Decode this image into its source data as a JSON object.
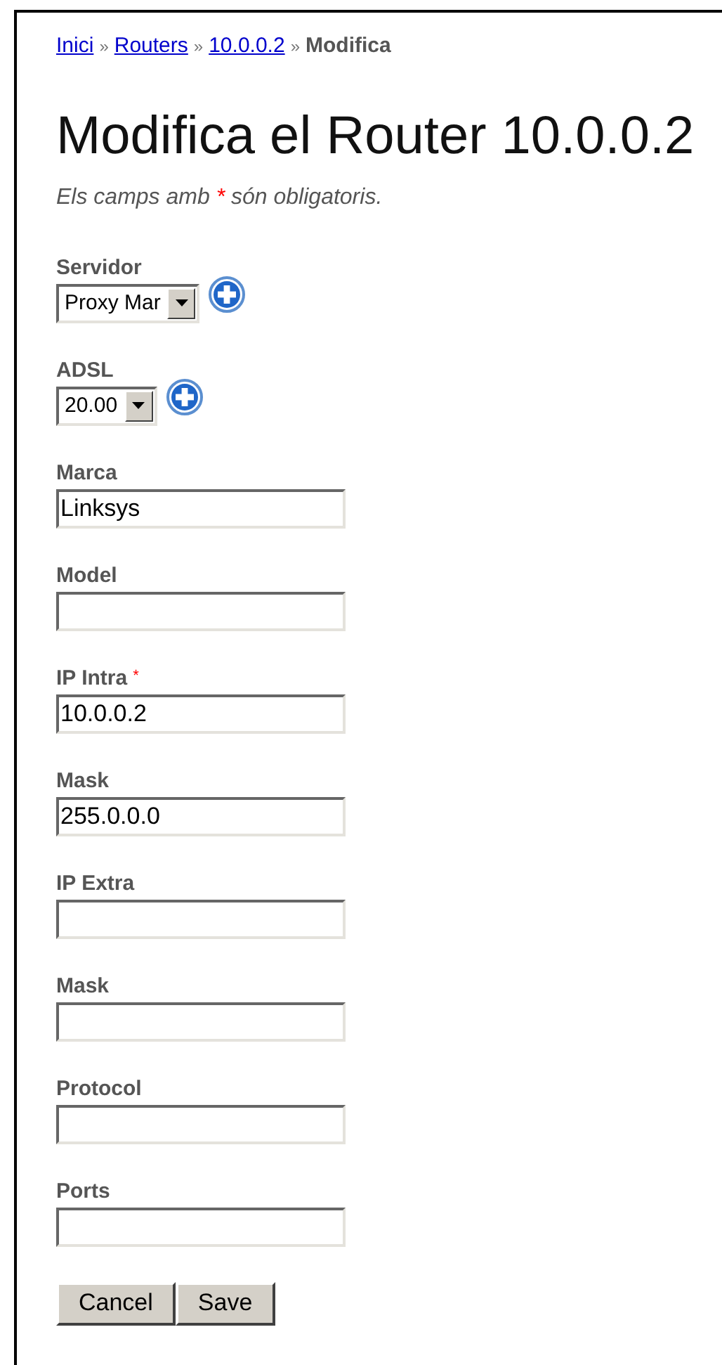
{
  "breadcrumb": [
    {
      "kind": "link",
      "text": "Inici"
    },
    {
      "kind": "separator",
      "text": "»"
    },
    {
      "kind": "link",
      "text": "Routers"
    },
    {
      "kind": "separator",
      "text": "»"
    },
    {
      "kind": "link",
      "text": "10.0.0.2"
    },
    {
      "kind": "separator",
      "text": "»"
    },
    {
      "kind": "current",
      "text": "Modifica"
    }
  ],
  "title": "Modifica el Router 10.0.0.2",
  "note": {
    "before": "Els camps amb",
    "mark": "*",
    "after": "són obligatoris."
  },
  "fields": [
    {
      "kind": "select",
      "label": "Servidor",
      "value": "Proxy Mar"
    },
    {
      "kind": "select",
      "label": "ADSL",
      "value": "20.00"
    },
    {
      "kind": "text",
      "label": "Marca",
      "value": "Linksys"
    },
    {
      "kind": "text",
      "label": "Model"
    },
    {
      "kind": "text",
      "label": "IP Intra",
      "value": "10.0.0.2",
      "mark": "*"
    },
    {
      "kind": "text",
      "label": "Mask",
      "value": "255.0.0.0"
    },
    {
      "kind": "text",
      "label": "IP Extra"
    },
    {
      "kind": "text",
      "label": "Mask"
    },
    {
      "kind": "text",
      "label": "Protocol"
    },
    {
      "kind": "text",
      "label": "Ports"
    }
  ],
  "buttons": [
    "Cancel",
    "Save"
  ]
}
